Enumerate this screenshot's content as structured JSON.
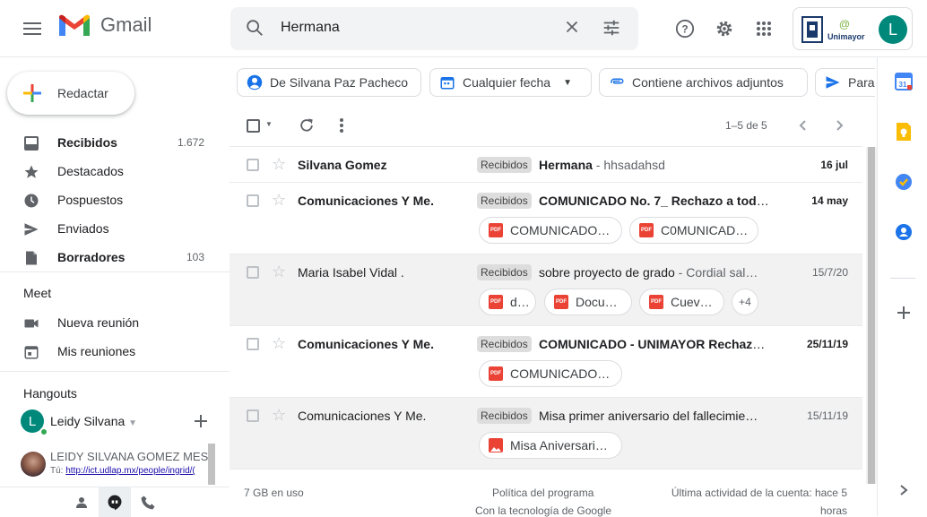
{
  "app": {
    "name": "Gmail"
  },
  "search": {
    "query": "Hermana"
  },
  "org_label": "Unimayor",
  "account": {
    "initial": "L"
  },
  "compose_label": "Redactar",
  "nav": [
    {
      "label": "Recibidos",
      "count": "1.672",
      "bold": true,
      "icon": "inbox-icon"
    },
    {
      "label": "Destacados",
      "count": "",
      "bold": false,
      "icon": "star-icon"
    },
    {
      "label": "Pospuestos",
      "count": "",
      "bold": false,
      "icon": "clock-icon"
    },
    {
      "label": "Enviados",
      "count": "",
      "bold": false,
      "icon": "send-icon"
    },
    {
      "label": "Borradores",
      "count": "103",
      "bold": true,
      "icon": "draft-icon"
    }
  ],
  "meet": {
    "title": "Meet",
    "new_meeting": "Nueva reunión",
    "my_meetings": "Mis reuniones"
  },
  "hangouts": {
    "title": "Hangouts",
    "user_initial": "L",
    "user_name": "Leidy Silvana",
    "contact_name": "LEIDY SILVANA GOMEZ MES",
    "contact_prefix": "Tú:",
    "contact_link": "http://ict.udlap.mx/people/ingrid/("
  },
  "filters": [
    {
      "label": "De Silvana Paz Pacheco",
      "icon": "person-icon"
    },
    {
      "label": "Cualquier fecha",
      "icon": "calendar-icon"
    },
    {
      "label": "Contiene archivos adjuntos",
      "icon": "attachment-icon"
    },
    {
      "label": "Para",
      "icon": "send-icon"
    }
  ],
  "pagination": "1–5 de 5",
  "emails": [
    {
      "sender": "Silvana Gomez",
      "label": "Recibidos",
      "subject": "Hermana",
      "snippet": " - hhsadahsd",
      "date": "16 jul",
      "unread": true,
      "attachments": []
    },
    {
      "sender": "Comunicaciones Y Me.",
      "label": "Recibidos",
      "subject": "COMUNICADO No. 7_ Rechazo a todo…",
      "snippet": "",
      "date": "14 may",
      "unread": true,
      "attachments": [
        {
          "name": "COMUNICADO …",
          "type": "pdf"
        },
        {
          "name": "C0MUNICAD…",
          "type": "pdf"
        }
      ]
    },
    {
      "sender": "Maria Isabel Vidal .",
      "label": "Recibidos",
      "subject": "sobre proyecto de grado",
      "snippet": " - Cordial sal…",
      "date": "15/7/20",
      "unread": false,
      "attachments": [
        {
          "name": "d…",
          "type": "pdf"
        },
        {
          "name": "Docu…",
          "type": "pdf"
        },
        {
          "name": "Cuev…",
          "type": "pdf"
        }
      ],
      "more": "+4"
    },
    {
      "sender": "Comunicaciones Y Me.",
      "label": "Recibidos",
      "subject": "COMUNICADO - UNIMAYOR Rechaza…",
      "snippet": "",
      "date": "25/11/19",
      "unread": true,
      "attachments": [
        {
          "name": "COMUNICADO -…",
          "type": "pdf"
        }
      ]
    },
    {
      "sender": "Comunicaciones Y Me.",
      "label": "Recibidos",
      "subject": "Misa primer aniversario del fallecimie…",
      "snippet": "",
      "date": "15/11/19",
      "unread": false,
      "attachments": [
        {
          "name": "Misa Aniversari…",
          "type": "image"
        }
      ]
    }
  ],
  "footer": {
    "storage": "7 GB en uso",
    "policy": "Política del programa",
    "powered": "Con la tecnología de Google",
    "activity1": "Última actividad de la cuenta: hace 5",
    "activity2": "horas"
  },
  "pdf_badge": "PDF",
  "colors": {
    "gmail_red": "#ea4335",
    "accent_blue": "#1a73e8",
    "avatar": "#00897b"
  }
}
